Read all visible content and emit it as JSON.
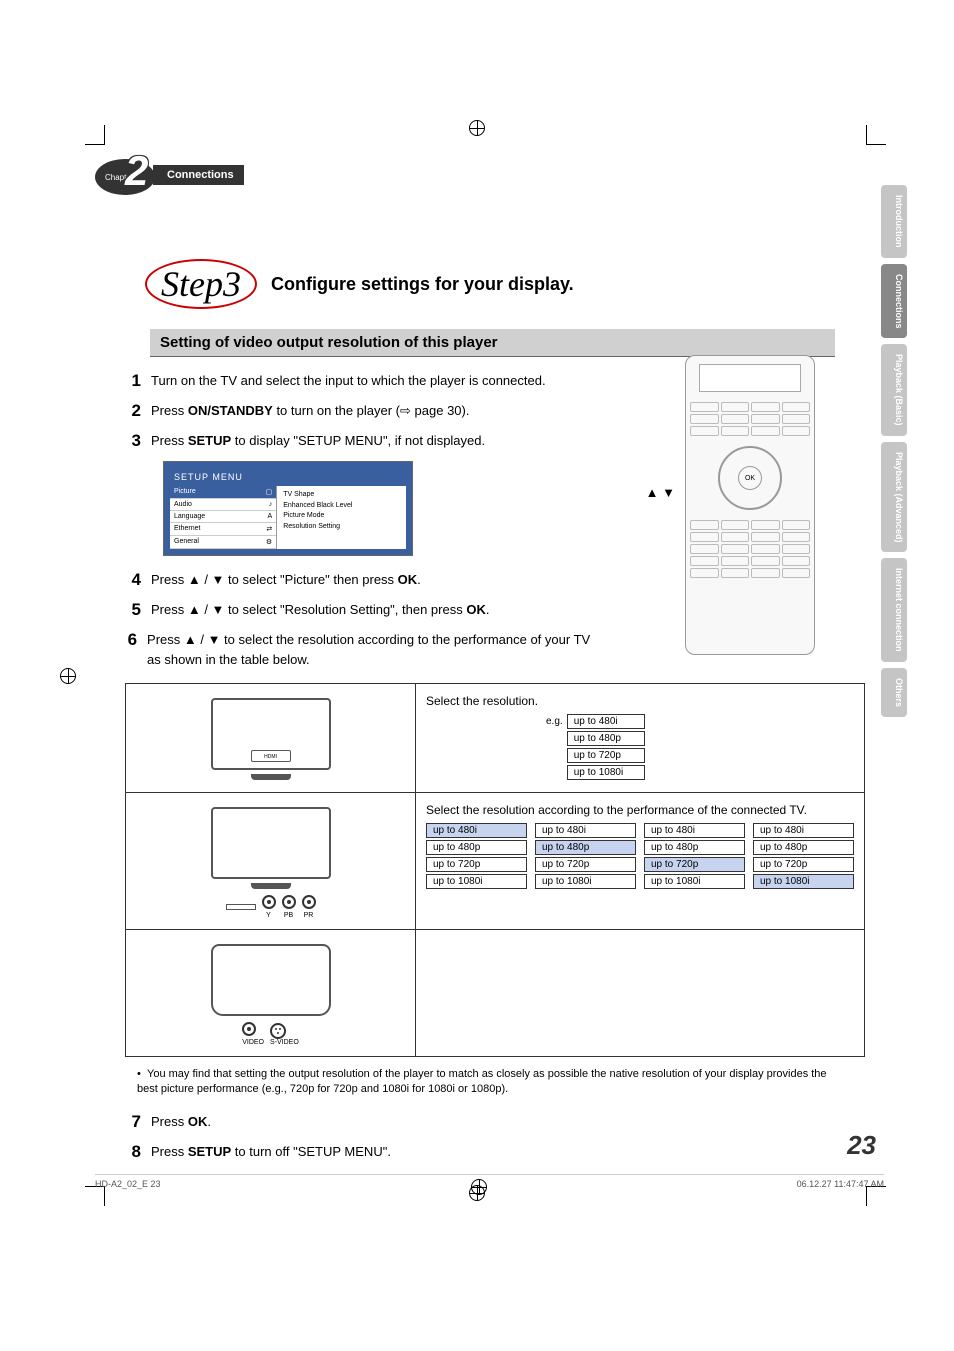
{
  "chapter": {
    "label": "Chapter",
    "number": "2",
    "title": "Connections"
  },
  "side_tabs": [
    {
      "label": "Introduction",
      "active": false
    },
    {
      "label": "Connections",
      "active": true
    },
    {
      "label": "Playback (Basic)",
      "active": false
    },
    {
      "label": "Playback (Advanced)",
      "active": false
    },
    {
      "label": "Internet connection",
      "active": false
    },
    {
      "label": "Others",
      "active": false
    }
  ],
  "step_badge": "Step3",
  "step_title": "Configure settings for your display.",
  "subheading": "Setting of video output resolution of this player",
  "steps": [
    {
      "n": "1",
      "text_parts": [
        "Turn on the TV and select the input to which the player is connected."
      ]
    },
    {
      "n": "2",
      "text_parts": [
        "Press ",
        "ON/STANDBY",
        " to turn on the player (",
        "⇨",
        " page 30)."
      ]
    },
    {
      "n": "3",
      "text_parts": [
        "Press ",
        "SETUP",
        " to display \"SETUP MENU\", if not displayed."
      ]
    },
    {
      "n": "4",
      "text_parts": [
        "Press ▲ / ▼ to select \"Picture\" then press ",
        "OK",
        "."
      ]
    },
    {
      "n": "5",
      "text_parts": [
        "Press ▲ / ▼ to select \"Resolution Setting\", then press ",
        "OK",
        "."
      ]
    },
    {
      "n": "6",
      "text_parts": [
        "Press ▲ / ▼ to select the resolution according to the performance of your TV as shown in the table below."
      ]
    },
    {
      "n": "7",
      "text_parts": [
        "Press ",
        "OK",
        "."
      ]
    },
    {
      "n": "8",
      "text_parts": [
        "Press ",
        "SETUP",
        " to turn off \"SETUP MENU\"."
      ]
    }
  ],
  "setup_menu": {
    "title": "SETUP MENU",
    "left": [
      "Picture",
      "Audio",
      "Language",
      "Ethernet",
      "General"
    ],
    "right": [
      "TV Shape",
      "Enhanced Black Level",
      "Picture Mode",
      "Resolution Setting"
    ]
  },
  "arrows_label": "▲ ▼",
  "remote_ok": "OK",
  "table": {
    "row1_title": "Select the resolution.",
    "eg_label": "e.g.",
    "row1_options": [
      "up to 480i",
      "up to 480p",
      "up to 720p",
      "up to 1080i"
    ],
    "row2_title": "Select the resolution according to the performance of the connected TV.",
    "row2_cols": [
      {
        "options": [
          "up to 480i",
          "up to 480p",
          "up to 720p",
          "up to 1080i"
        ],
        "highlight": 0
      },
      {
        "options": [
          "up to 480i",
          "up to 480p",
          "up to 720p",
          "up to 1080i"
        ],
        "highlight": 1
      },
      {
        "options": [
          "up to 480i",
          "up to 480p",
          "up to 720p",
          "up to 1080i"
        ],
        "highlight": 2
      },
      {
        "options": [
          "up to 480i",
          "up to 480p",
          "up to 720p",
          "up to 1080i"
        ],
        "highlight": 3
      }
    ],
    "conn_labels": {
      "y": "Y",
      "pb": "PB",
      "pr": "PR",
      "video": "VIDEO",
      "svideo": "S-VIDEO"
    },
    "hdmi": "HDMI"
  },
  "note": "You may find that setting the output resolution of the player to match as closely as possible the native resolution of your display provides the best picture performance (e.g., 720p for 720p and 1080i for 1080i or 1080p).",
  "page_number": "23",
  "footer_left": "HD-A2_02_E   23",
  "footer_right": "06.12.27   11:47:47 AM"
}
